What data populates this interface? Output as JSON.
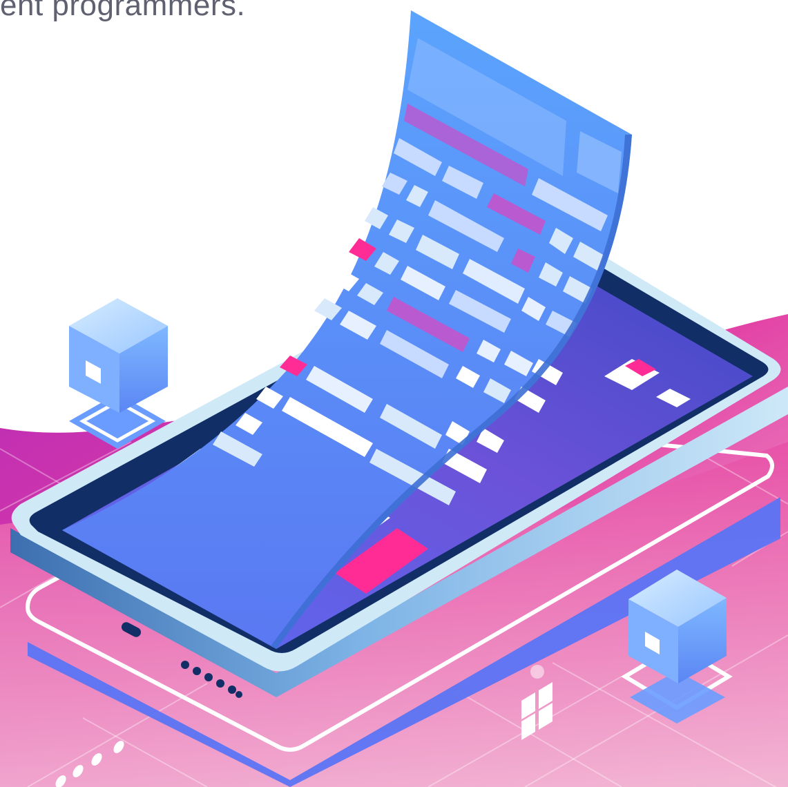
{
  "headline": {
    "text": "ent programmers."
  },
  "illustration": {
    "subject": "isometric-smartphone-with-curling-page",
    "icons": [
      "smartphone-icon",
      "cube-icon",
      "cube-icon",
      "grid-tile-icon"
    ]
  },
  "colors": {
    "text": "#5f6170",
    "background": "#ffffff",
    "wave_magenta": "#d6239f",
    "wave_pink": "#f3b3d4",
    "phone_body": "#cfe9f7",
    "phone_bezel": "#112f66",
    "screen_blue": "#5d6ef0",
    "page_blue": "#5ca6fd",
    "accent_pink": "#ff2c96",
    "cube_blue": "#6aa9ff"
  }
}
